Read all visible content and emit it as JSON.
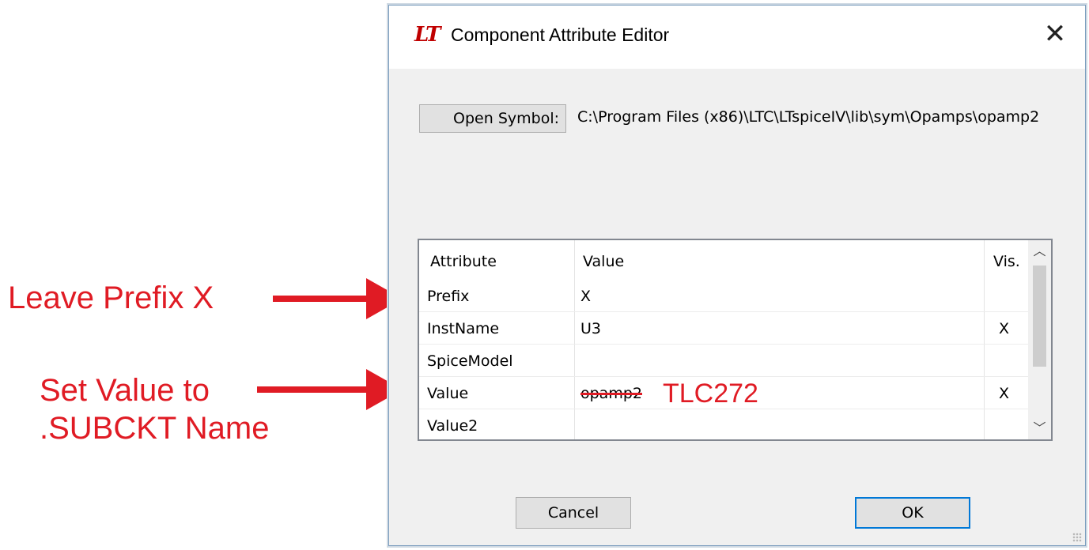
{
  "dialog": {
    "title": "Component Attribute Editor",
    "app_icon": "LT",
    "close_glyph": "✕",
    "open_symbol_label": "Open Symbol:",
    "symbol_path": "C:\\Program Files (x86)\\LTC\\LTspiceIV\\lib\\sym\\Opamps\\opamp2",
    "buttons": {
      "cancel": "Cancel",
      "ok": "OK"
    }
  },
  "grid": {
    "columns": [
      "Attribute",
      "Value",
      "Vis."
    ],
    "rows": [
      {
        "attribute": "Prefix",
        "value": "X",
        "vis": ""
      },
      {
        "attribute": "InstName",
        "value": "U3",
        "vis": "X"
      },
      {
        "attribute": "SpiceModel",
        "value": "",
        "vis": ""
      },
      {
        "attribute": "Value",
        "value": "opamp2",
        "vis": "X",
        "new_value": "TLC272"
      },
      {
        "attribute": "Value2",
        "value": "",
        "vis": ""
      }
    ],
    "scroll_up_icon": "chevron-up-icon",
    "scroll_down_icon": "chevron-down-icon"
  },
  "annotations": {
    "prefix_note": "Leave Prefix X",
    "value_note_line1": "Set Value to",
    "value_note_line2": ".SUBCKT Name",
    "color": "#e01b24"
  }
}
